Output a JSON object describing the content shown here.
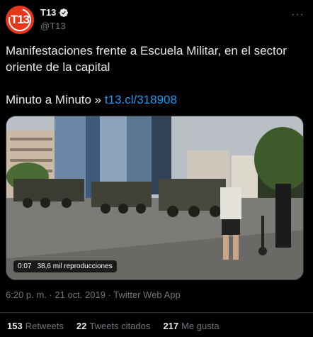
{
  "account": {
    "avatar_text": "T13",
    "display_name": "T13",
    "handle": "@T13",
    "verified": true,
    "brand_color": "#e8361a"
  },
  "tweet": {
    "line1": "Manifestaciones frente a Escuela Militar, en el sector oriente de la capital",
    "link_prefix": "Minuto a Minuto » ",
    "link_text": "t13.cl/318908"
  },
  "media": {
    "duration": "0:07",
    "views": "38,6 mil reproducciones"
  },
  "meta": {
    "time": "6:20 p. m.",
    "separator1": " · ",
    "date": "21 oct. 2019",
    "separator2": " · ",
    "source": "Twitter Web App"
  },
  "stats": {
    "retweets_count": "153",
    "retweets_label": "Retweets",
    "quotes_count": "22",
    "quotes_label": "Tweets citados",
    "likes_count": "217",
    "likes_label": "Me gusta"
  },
  "icons": {
    "more": "more-options-icon",
    "verified": "verified-badge-icon"
  },
  "colors": {
    "link": "#1d9bf0",
    "secondary_text": "#71767b",
    "background": "#000000"
  }
}
